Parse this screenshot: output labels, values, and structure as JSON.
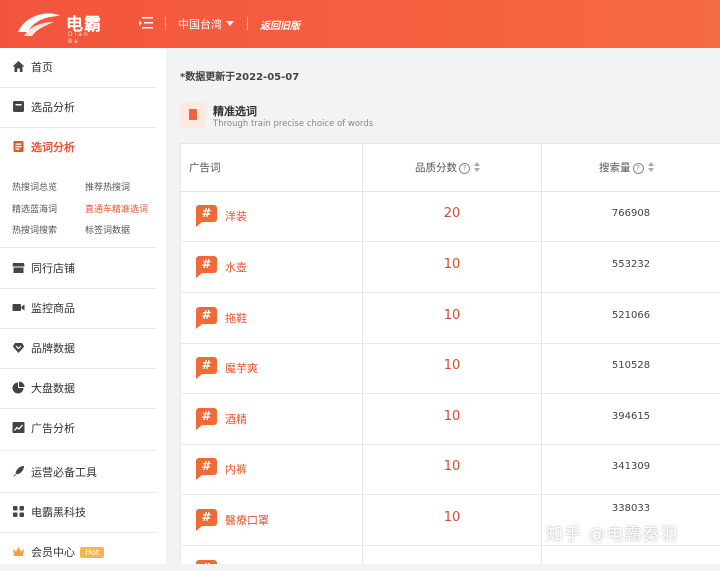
{
  "brand": {
    "name": "电霸",
    "sub": "Dian Ba"
  },
  "topbar": {
    "region": "中国台湾",
    "old_version": "返回旧版"
  },
  "sidebar": {
    "items": [
      {
        "label": "首页",
        "icon": "home-icon"
      },
      {
        "label": "选品分析",
        "icon": "box-icon"
      },
      {
        "label": "选词分析",
        "icon": "words-icon",
        "active": true
      },
      {
        "label": "同行店铺",
        "icon": "store-icon"
      },
      {
        "label": "监控商品",
        "icon": "camera-icon"
      },
      {
        "label": "品牌数据",
        "icon": "brand-icon"
      },
      {
        "label": "大盘数据",
        "icon": "pie-chart-icon"
      },
      {
        "label": "广告分析",
        "icon": "trend-chart-icon"
      },
      {
        "label": "运营必备工具",
        "icon": "rocket-icon"
      },
      {
        "label": "电霸黑科技",
        "icon": "grid-icon"
      },
      {
        "label": "会员中心",
        "icon": "crown-icon",
        "badge": "Hot"
      }
    ],
    "sub_items": [
      {
        "label": "热搜词总览"
      },
      {
        "label": "推荐热搜词"
      },
      {
        "label": "精选蓝海词"
      },
      {
        "label": "直通车精准选词",
        "active": true
      },
      {
        "label": "热搜词搜索"
      },
      {
        "label": "标签词数据"
      }
    ]
  },
  "main": {
    "update_note": "*数据更新于2022-05-07",
    "card_title": "精准选词",
    "card_subtitle": "Through train precise choice of words",
    "columns": [
      "广告词",
      "品质分数",
      "搜索量"
    ],
    "rows": [
      {
        "keyword": "洋装",
        "score": "20",
        "volume": "766908"
      },
      {
        "keyword": "水壺",
        "score": "10",
        "volume": "553232"
      },
      {
        "keyword": "拖鞋",
        "score": "10",
        "volume": "521066"
      },
      {
        "keyword": "魔芋爽",
        "score": "10",
        "volume": "510528"
      },
      {
        "keyword": "酒精",
        "score": "10",
        "volume": "394615"
      },
      {
        "keyword": "内裤",
        "score": "10",
        "volume": "341309"
      },
      {
        "keyword": "醫療口罩",
        "score": "10",
        "volume": "338033"
      }
    ]
  },
  "watermark": "知乎 @电霸秦羽",
  "colors": {
    "accent": "#f2553c",
    "active_text": "#e8542f",
    "tag": "#f06a38",
    "hot_badge": "#f5b54a"
  }
}
